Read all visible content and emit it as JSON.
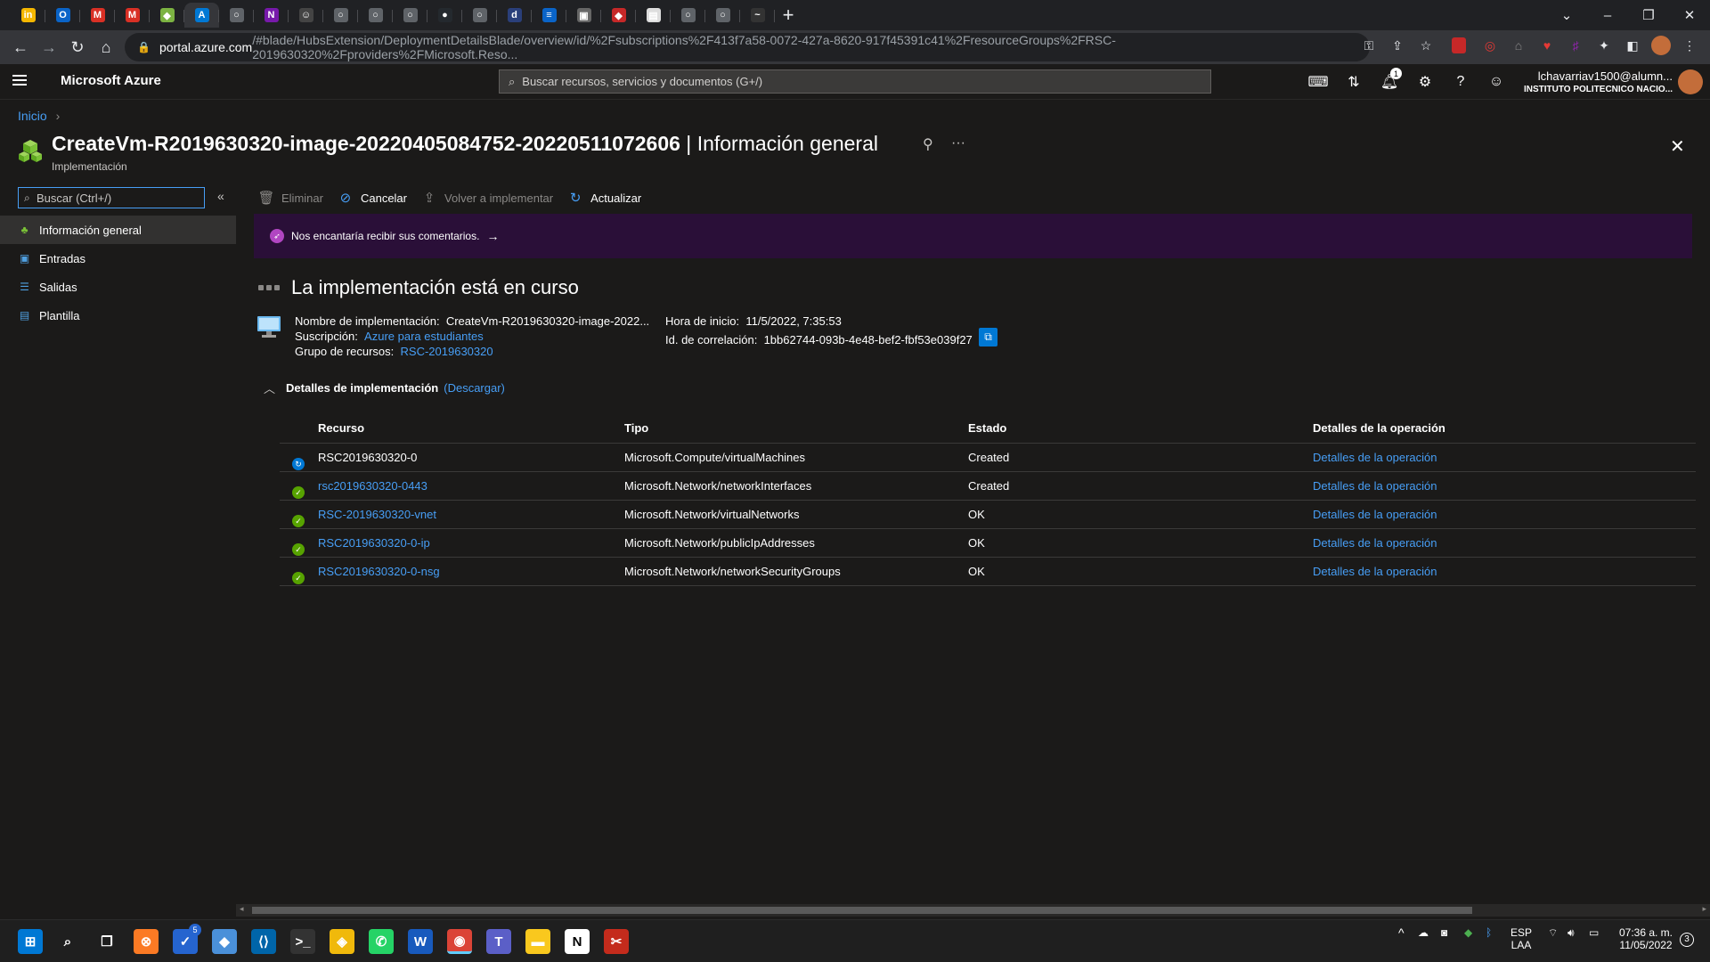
{
  "browser": {
    "tabs": [
      {
        "icon": "in-icon",
        "glyph": "in",
        "color": "#f5b700"
      },
      {
        "icon": "outlook-icon",
        "glyph": "O",
        "color": "#0a64c8"
      },
      {
        "icon": "gmail-icon",
        "glyph": "M",
        "color": "#d93025"
      },
      {
        "icon": "gmail-icon",
        "glyph": "M",
        "color": "#d93025"
      },
      {
        "icon": "app-icon",
        "glyph": "◆",
        "color": "#7cb342"
      },
      {
        "icon": "azure-icon",
        "glyph": "A",
        "color": "#0078d4"
      },
      {
        "icon": "generic-icon",
        "glyph": "○",
        "color": "#5f6368"
      },
      {
        "icon": "onenote-icon",
        "glyph": "N",
        "color": "#7719aa"
      },
      {
        "icon": "person-icon",
        "glyph": "☺",
        "color": "#444"
      },
      {
        "icon": "generic-icon",
        "glyph": "○",
        "color": "#5f6368"
      },
      {
        "icon": "generic-icon",
        "glyph": "○",
        "color": "#5f6368"
      },
      {
        "icon": "generic-icon",
        "glyph": "○",
        "color": "#5f6368"
      },
      {
        "icon": "github-icon",
        "glyph": "●",
        "color": "#24292e"
      },
      {
        "icon": "generic-icon",
        "glyph": "○",
        "color": "#5f6368"
      },
      {
        "icon": "site-icon",
        "glyph": "d",
        "color": "#2a3f7a"
      },
      {
        "icon": "site-icon",
        "glyph": "≡",
        "color": "#0a64c8"
      },
      {
        "icon": "image-icon",
        "glyph": "▣",
        "color": "#666"
      },
      {
        "icon": "shield-icon",
        "glyph": "◆",
        "color": "#c62828"
      },
      {
        "icon": "doc-icon",
        "glyph": "▤",
        "color": "#ddd"
      },
      {
        "icon": "generic-icon",
        "glyph": "○",
        "color": "#5f6368"
      },
      {
        "icon": "generic-icon",
        "glyph": "○",
        "color": "#5f6368"
      },
      {
        "icon": "wave-icon",
        "glyph": "~",
        "color": "#333"
      }
    ],
    "url_host": "portal.azure.com",
    "url_path": "/#blade/HubsExtension/DeploymentDetailsBlade/overview/id/%2Fsubscriptions%2F413f7a58-0072-427a-8620-917f45391c41%2FresourceGroups%2FRSC-2019630320%2Fproviders%2FMicrosoft.Reso..."
  },
  "header": {
    "brand": "Microsoft Azure",
    "search_placeholder": "Buscar recursos, servicios y documentos (G+/)",
    "notification_count": "1",
    "user_name": "lchavarriav1500@alumn...",
    "user_org": "INSTITUTO POLITECNICO NACIO..."
  },
  "breadcrumb": {
    "home": "Inicio"
  },
  "page": {
    "title_main": "CreateVm-R2019630320-image-20220405084752-20220511072606",
    "title_sep": " | ",
    "title_section": "Información general",
    "subtitle": "Implementación"
  },
  "sidebar": {
    "search_placeholder": "Buscar (Ctrl+/)",
    "items": [
      {
        "label": "Información general",
        "icon": "overview-icon"
      },
      {
        "label": "Entradas",
        "icon": "inputs-icon"
      },
      {
        "label": "Salidas",
        "icon": "outputs-icon"
      },
      {
        "label": "Plantilla",
        "icon": "template-icon"
      }
    ]
  },
  "commands": {
    "delete": "Eliminar",
    "cancel": "Cancelar",
    "redeploy": "Volver a implementar",
    "refresh": "Actualizar"
  },
  "banner": {
    "text": "Nos encantaría recibir sus comentarios."
  },
  "deployment": {
    "status_heading": "La implementación está en curso",
    "name_label": "Nombre de implementación:",
    "name_value": "CreateVm-R2019630320-image-2022...",
    "subscription_label": "Suscripción:",
    "subscription_value": "Azure para estudiantes",
    "rg_label": "Grupo de recursos:",
    "rg_value": "RSC-2019630320",
    "start_label": "Hora de inicio:",
    "start_value": "11/5/2022, 7:35:53",
    "corr_label": "Id. de correlación:",
    "corr_value": "1bb62744-093b-4e48-bef2-fbf53e039f27"
  },
  "details": {
    "heading": "Detalles de implementación",
    "download": "(Descargar)",
    "columns": [
      "Recurso",
      "Tipo",
      "Estado",
      "Detalles de la operación"
    ],
    "rows": [
      {
        "resource": "RSC2019630320-0",
        "type": "Microsoft.Compute/virtualMachines",
        "state": "Created",
        "op": "Detalles de la operación",
        "status": "running",
        "linked": false
      },
      {
        "resource": "rsc2019630320-0443",
        "type": "Microsoft.Network/networkInterfaces",
        "state": "Created",
        "op": "Detalles de la operación",
        "status": "ok",
        "linked": true
      },
      {
        "resource": "RSC-2019630320-vnet",
        "type": "Microsoft.Network/virtualNetworks",
        "state": "OK",
        "op": "Detalles de la operación",
        "status": "ok",
        "linked": true
      },
      {
        "resource": "RSC2019630320-0-ip",
        "type": "Microsoft.Network/publicIpAddresses",
        "state": "OK",
        "op": "Detalles de la operación",
        "status": "ok",
        "linked": true
      },
      {
        "resource": "RSC2019630320-0-nsg",
        "type": "Microsoft.Network/networkSecurityGroups",
        "state": "OK",
        "op": "Detalles de la operación",
        "status": "ok",
        "linked": true
      }
    ]
  },
  "taskbar": {
    "apps": [
      {
        "icon": "windows-start-icon",
        "glyph": "⊞",
        "color": "#0078d4"
      },
      {
        "icon": "search-icon",
        "glyph": "⌕",
        "color": "transparent"
      },
      {
        "icon": "task-view-icon",
        "glyph": "❐",
        "color": "transparent"
      },
      {
        "icon": "xampp-icon",
        "glyph": "⊗",
        "color": "#fb7a24"
      },
      {
        "icon": "tasks-icon",
        "glyph": "✓",
        "color": "#2564cf"
      },
      {
        "icon": "git-icon",
        "glyph": "◆",
        "color": "#4a90d9"
      },
      {
        "icon": "vscode-icon",
        "glyph": "⟨⟩",
        "color": "#0065a9"
      },
      {
        "icon": "terminal-icon",
        "glyph": ">_",
        "color": "#333"
      },
      {
        "icon": "binance-icon",
        "glyph": "◈",
        "color": "#f0b90b"
      },
      {
        "icon": "whatsapp-icon",
        "glyph": "✆",
        "color": "#25d366"
      },
      {
        "icon": "word-icon",
        "glyph": "W",
        "color": "#185abd"
      },
      {
        "icon": "chrome-icon",
        "glyph": "◉",
        "color": "#db4437"
      },
      {
        "icon": "teams-icon",
        "glyph": "T",
        "color": "#5b5fc7"
      },
      {
        "icon": "explorer-icon",
        "glyph": "▬",
        "color": "#f9c81e"
      },
      {
        "icon": "notion-icon",
        "glyph": "N",
        "color": "#fff"
      },
      {
        "icon": "snip-icon",
        "glyph": "✂",
        "color": "#c42b1c"
      }
    ],
    "badge_tasks": "5",
    "lang_top": "ESP",
    "lang_bottom": "LAA",
    "time": "07:36 a. m.",
    "date": "11/05/2022",
    "notif": "3"
  }
}
